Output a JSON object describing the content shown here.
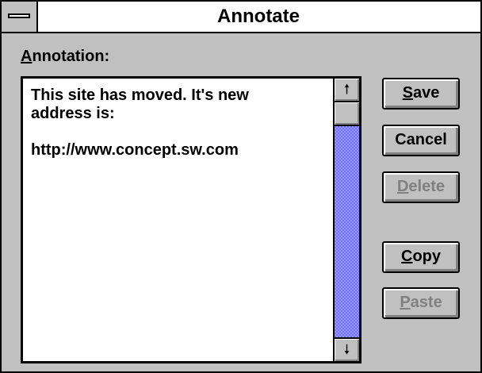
{
  "window": {
    "title": "Annotate"
  },
  "annotation": {
    "label_mnemonic": "A",
    "label_rest": "nnotation:",
    "text": "This site has moved. It's new\naddress is:\n\nhttp://www.concept.sw.com"
  },
  "scrollbar": {
    "up_glyph": "🠕",
    "down_glyph": "🠗",
    "thumb_position": 0
  },
  "buttons": {
    "save": {
      "mnemonic": "S",
      "rest": "ave",
      "enabled": true
    },
    "cancel": {
      "mnemonic": "",
      "rest": "Cancel",
      "enabled": true
    },
    "delete": {
      "mnemonic": "D",
      "rest": "elete",
      "enabled": false
    },
    "copy": {
      "mnemonic": "C",
      "rest": "opy",
      "enabled": true
    },
    "paste": {
      "mnemonic": "P",
      "rest": "aste",
      "enabled": false
    }
  },
  "colors": {
    "scroll_track": "#6b6bff",
    "face": "#c0c0c0",
    "disabled_text": "#808080"
  }
}
